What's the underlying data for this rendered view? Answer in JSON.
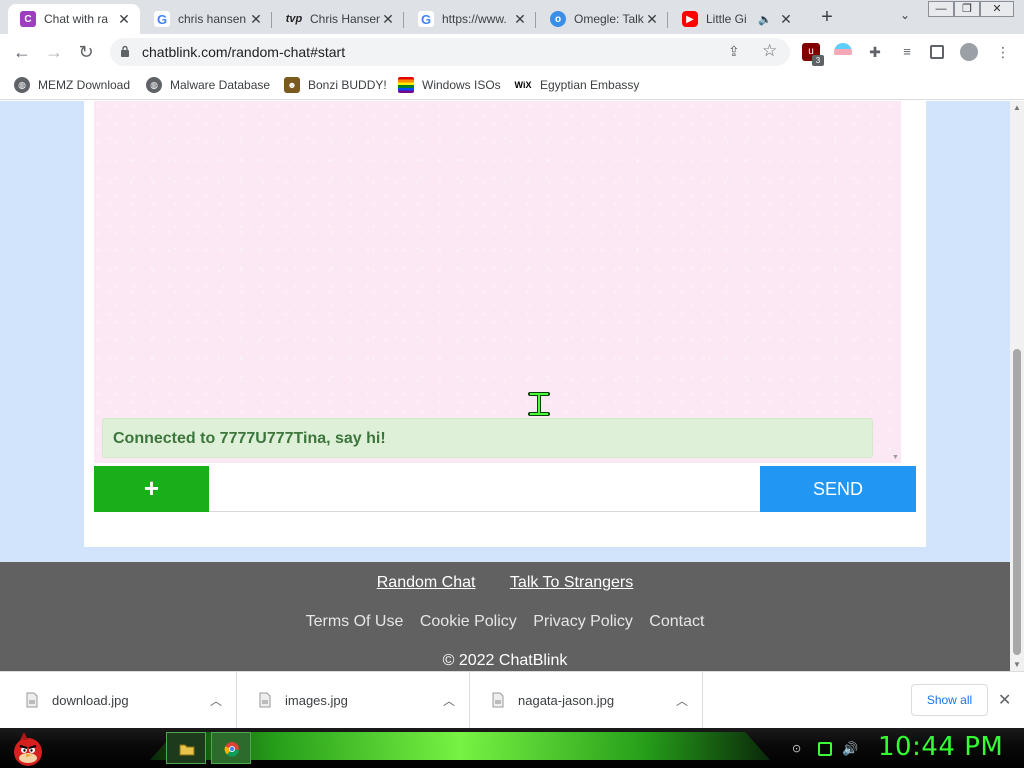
{
  "browser": {
    "tabs": [
      {
        "title": "Chat with ra",
        "favicon": "chatblink-c-icon",
        "active": true
      },
      {
        "title": "chris hansen",
        "favicon": "google-icon"
      },
      {
        "title": "Chris Hansen",
        "favicon": "tvp-icon"
      },
      {
        "title": "https://www.",
        "favicon": "google-icon"
      },
      {
        "title": "Omegle: Talk",
        "favicon": "omegle-icon"
      },
      {
        "title": "Little Gi",
        "favicon": "youtube-icon",
        "audio": true
      }
    ],
    "new_tab_symbol": "+",
    "url": "chatblink.com/random-chat#start",
    "extension_badge": "3",
    "bookmarks": [
      {
        "label": "MEMZ Download",
        "icon": "globe-icon"
      },
      {
        "label": "Malware Database",
        "icon": "globe-icon"
      },
      {
        "label": "Bonzi BUDDY!",
        "icon": "bonzi-icon"
      },
      {
        "label": "Windows ISOs",
        "icon": "windows-flag-icon"
      },
      {
        "label": "Egyptian Embassy",
        "icon": "wix-icon"
      }
    ]
  },
  "chat": {
    "system_message": "Connected to 7777U777Tina, say hi!",
    "plus_label": "+",
    "input_value": "",
    "send_label": "SEND",
    "colors": {
      "plus": "#1aaf1a",
      "send": "#2196f3",
      "log_bg": "#fbe8f4",
      "status_bg": "#dff0d8",
      "status_text": "#3c763d"
    }
  },
  "footer": {
    "links_primary": [
      "Random Chat",
      "Talk To Strangers"
    ],
    "links_secondary": [
      "Terms Of Use",
      "Cookie Policy",
      "Privacy Policy",
      "Contact"
    ],
    "copyright": "© 2022 ChatBlink"
  },
  "downloads": {
    "items": [
      "download.jpg",
      "images.jpg",
      "nagata-jason.jpg"
    ],
    "show_all_label": "Show all"
  },
  "taskbar": {
    "clock": "10:44 PM"
  }
}
